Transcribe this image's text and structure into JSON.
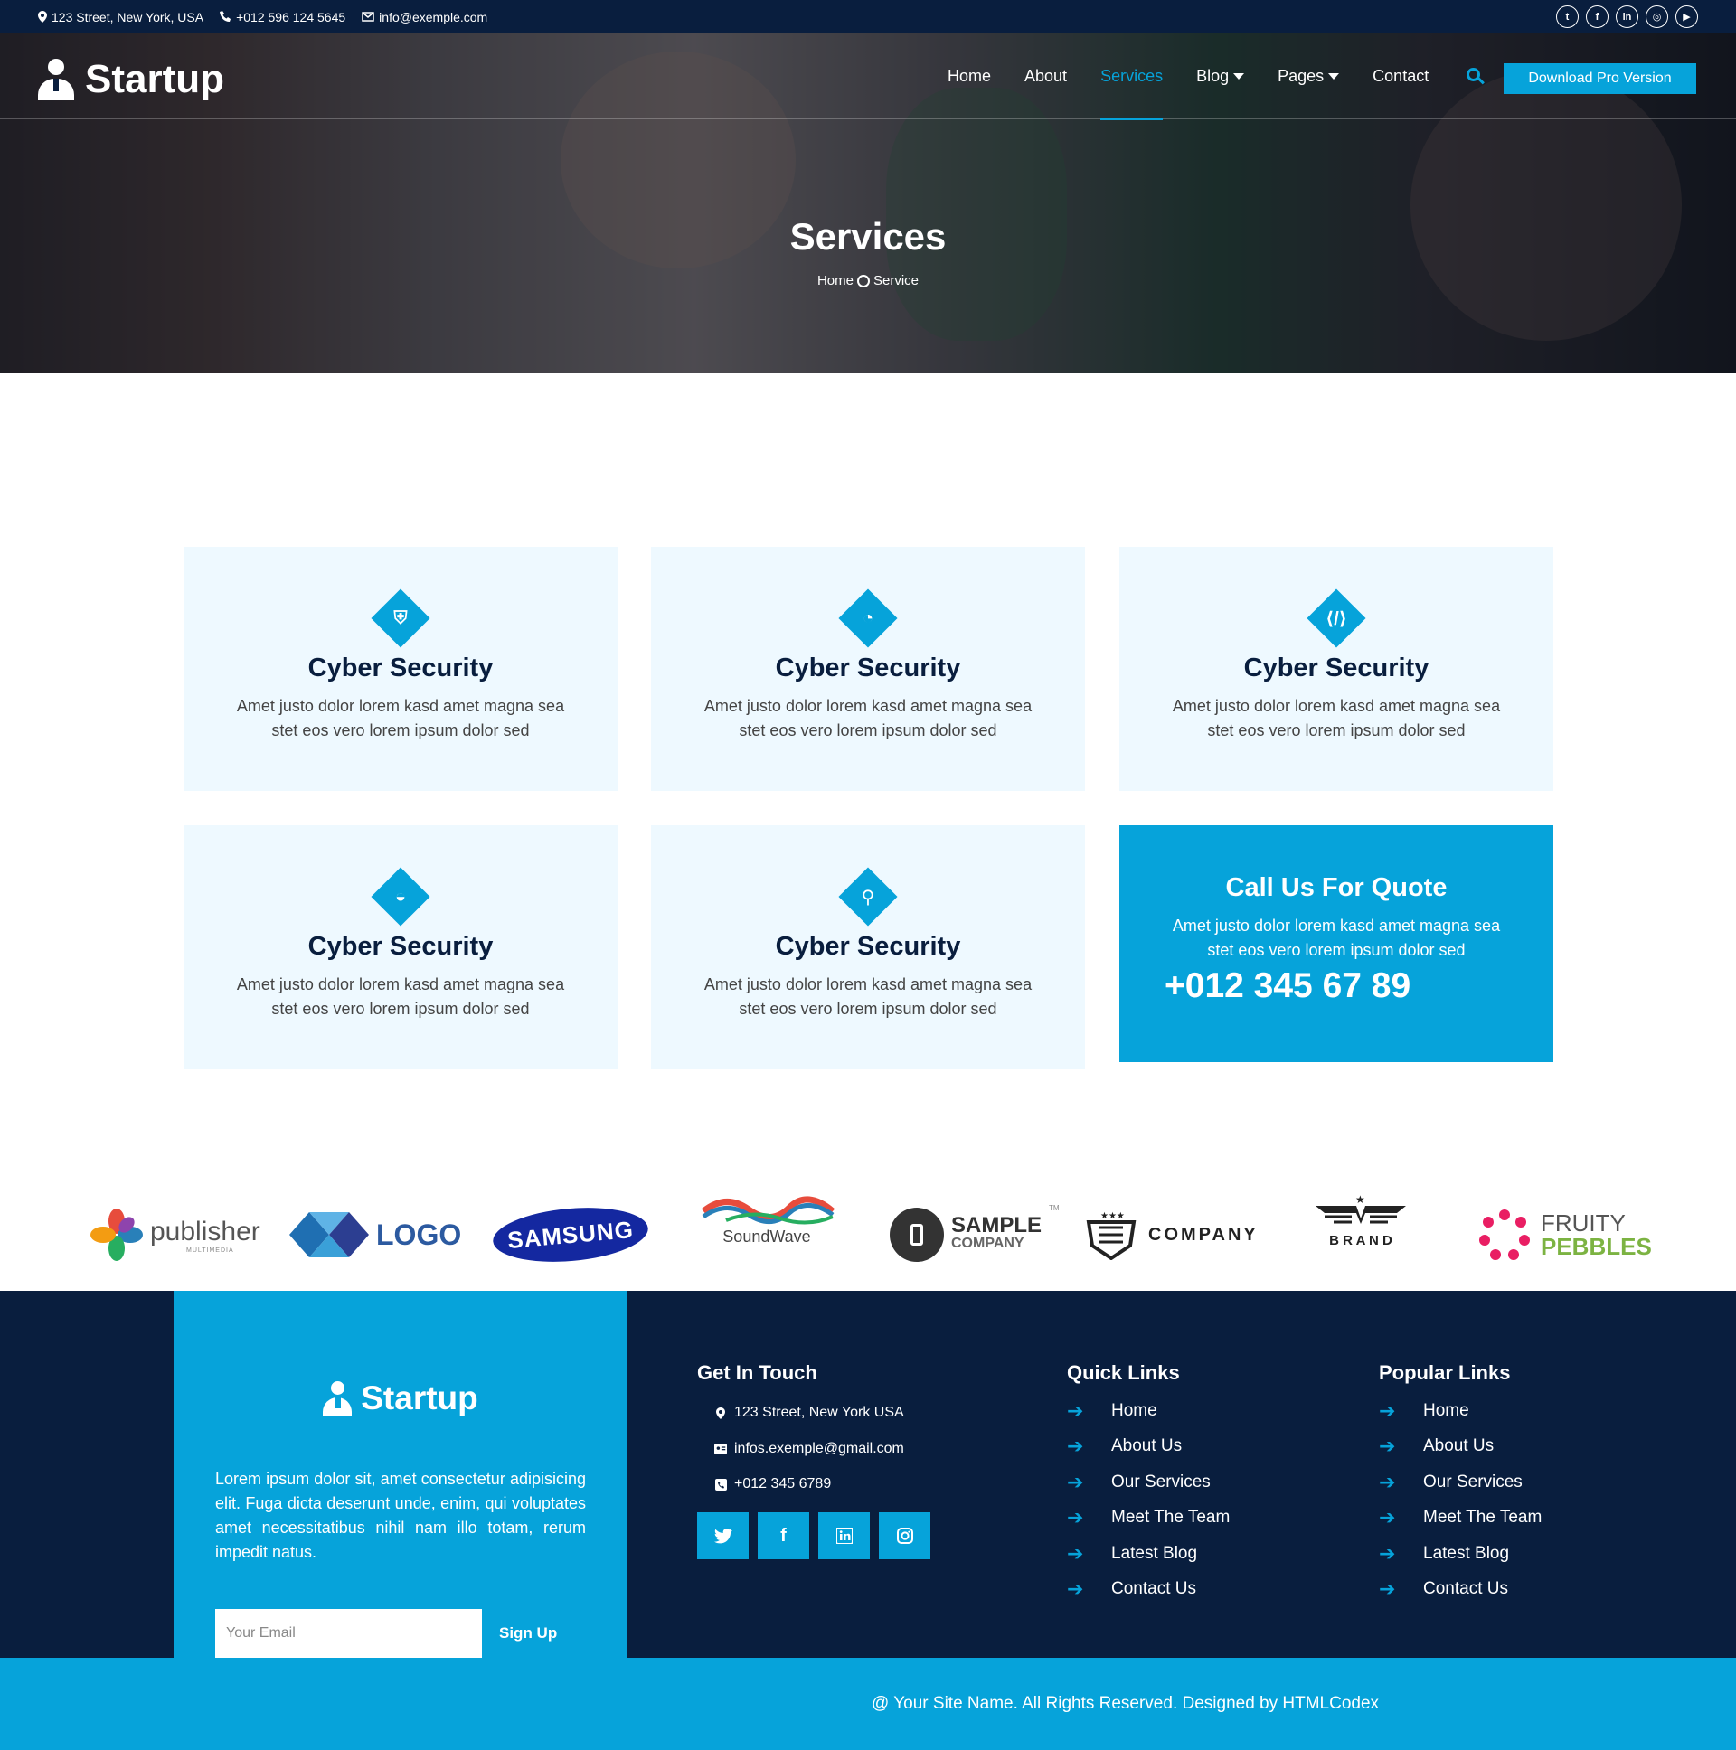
{
  "topbar": {
    "address": "123 Street, New York, USA",
    "phone": "+012 596 124 5645",
    "email": "info@exemple.com",
    "socials": [
      "twitter-icon",
      "facebook-icon",
      "linkedin-icon",
      "instagram-icon",
      "youtube-icon"
    ]
  },
  "navbar": {
    "brand": "Startup",
    "menu": [
      "Home",
      "About",
      "Services",
      "Blog",
      "Pages",
      "Contact"
    ],
    "active": "Services",
    "cta": "Download Pro Version"
  },
  "hero": {
    "title": "Services",
    "breadcrumb": [
      "Home",
      "Service"
    ]
  },
  "services": [
    {
      "icon": "shield-icon",
      "title": "Cyber Security",
      "desc": "Amet justo dolor lorem kasd amet magna sea stet eos vero lorem ipsum dolor sed"
    },
    {
      "icon": "chart-pie-icon",
      "title": "Cyber Security",
      "desc": "Amet justo dolor lorem kasd amet magna sea stet eos vero lorem ipsum dolor sed"
    },
    {
      "icon": "code-icon",
      "title": "Cyber Security",
      "desc": "Amet justo dolor lorem kasd amet magna sea stet eos vero lorem ipsum dolor sed"
    },
    {
      "icon": "android-icon",
      "title": "Cyber Security",
      "desc": "Amet justo dolor lorem kasd amet magna sea stet eos vero lorem ipsum dolor sed"
    },
    {
      "icon": "search-icon",
      "title": "Cyber Security",
      "desc": "Amet justo dolor lorem kasd amet magna sea stet eos vero lorem ipsum dolor sed"
    }
  ],
  "quote": {
    "title": "Call Us For Quote",
    "desc": "Amet justo dolor lorem kasd amet magna sea stet eos vero lorem ipsum dolor sed",
    "phone": "+012 345 67 89"
  },
  "logos": [
    "publisher",
    "MULTIMEDIA",
    "LOGO",
    "SAMSUNG",
    "SoundWave",
    "SAMPLE",
    "COMPANY",
    "COMPANY",
    "B R A N D",
    "FRUITY",
    "PEBBLES",
    "TM"
  ],
  "footer": {
    "brand": "Startup",
    "about": "Lorem ipsum dolor sit, amet consectetur adipisicing elit. Fuga dicta deserunt unde, enim, qui voluptates amet necessitatibus nihil nam illo totam, rerum impedit natus.",
    "email_placeholder": "Your Email",
    "signup": "Sign Up",
    "get_in_touch": {
      "title": "Get In Touch",
      "address": "123 Street, New York USA",
      "email": "infos.exemple@gmail.com",
      "phone": "+012 345 6789"
    },
    "quick_links": {
      "title": "Quick Links",
      "items": [
        "Home",
        "About Us",
        "Our Services",
        "Meet The Team",
        "Latest Blog",
        "Contact Us"
      ]
    },
    "popular_links": {
      "title": "Popular Links",
      "items": [
        "Home",
        "About Us",
        "Our Services",
        "Meet The Team",
        "Latest Blog",
        "Contact Us"
      ]
    },
    "copyright": "@ Your Site Name. All Rights Reserved. Designed by HTMLCodex"
  },
  "colors": {
    "dark": "#091e3e",
    "accent": "#06a3da",
    "card_bg": "#eef9ff"
  }
}
